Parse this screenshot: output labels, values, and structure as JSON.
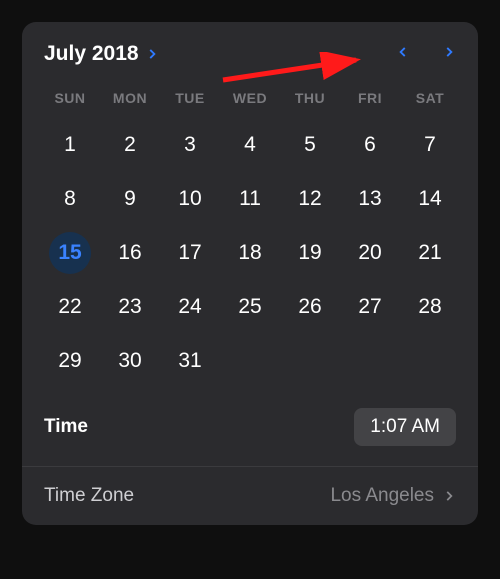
{
  "header": {
    "month_label": "July 2018"
  },
  "weekdays": [
    "SUN",
    "MON",
    "TUE",
    "WED",
    "THU",
    "FRI",
    "SAT"
  ],
  "days": [
    1,
    2,
    3,
    4,
    5,
    6,
    7,
    8,
    9,
    10,
    11,
    12,
    13,
    14,
    15,
    16,
    17,
    18,
    19,
    20,
    21,
    22,
    23,
    24,
    25,
    26,
    27,
    28,
    29,
    30,
    31
  ],
  "selected_day": 15,
  "time": {
    "label": "Time",
    "value": "1:07 AM"
  },
  "timezone": {
    "label": "Time Zone",
    "value": "Los Angeles"
  }
}
